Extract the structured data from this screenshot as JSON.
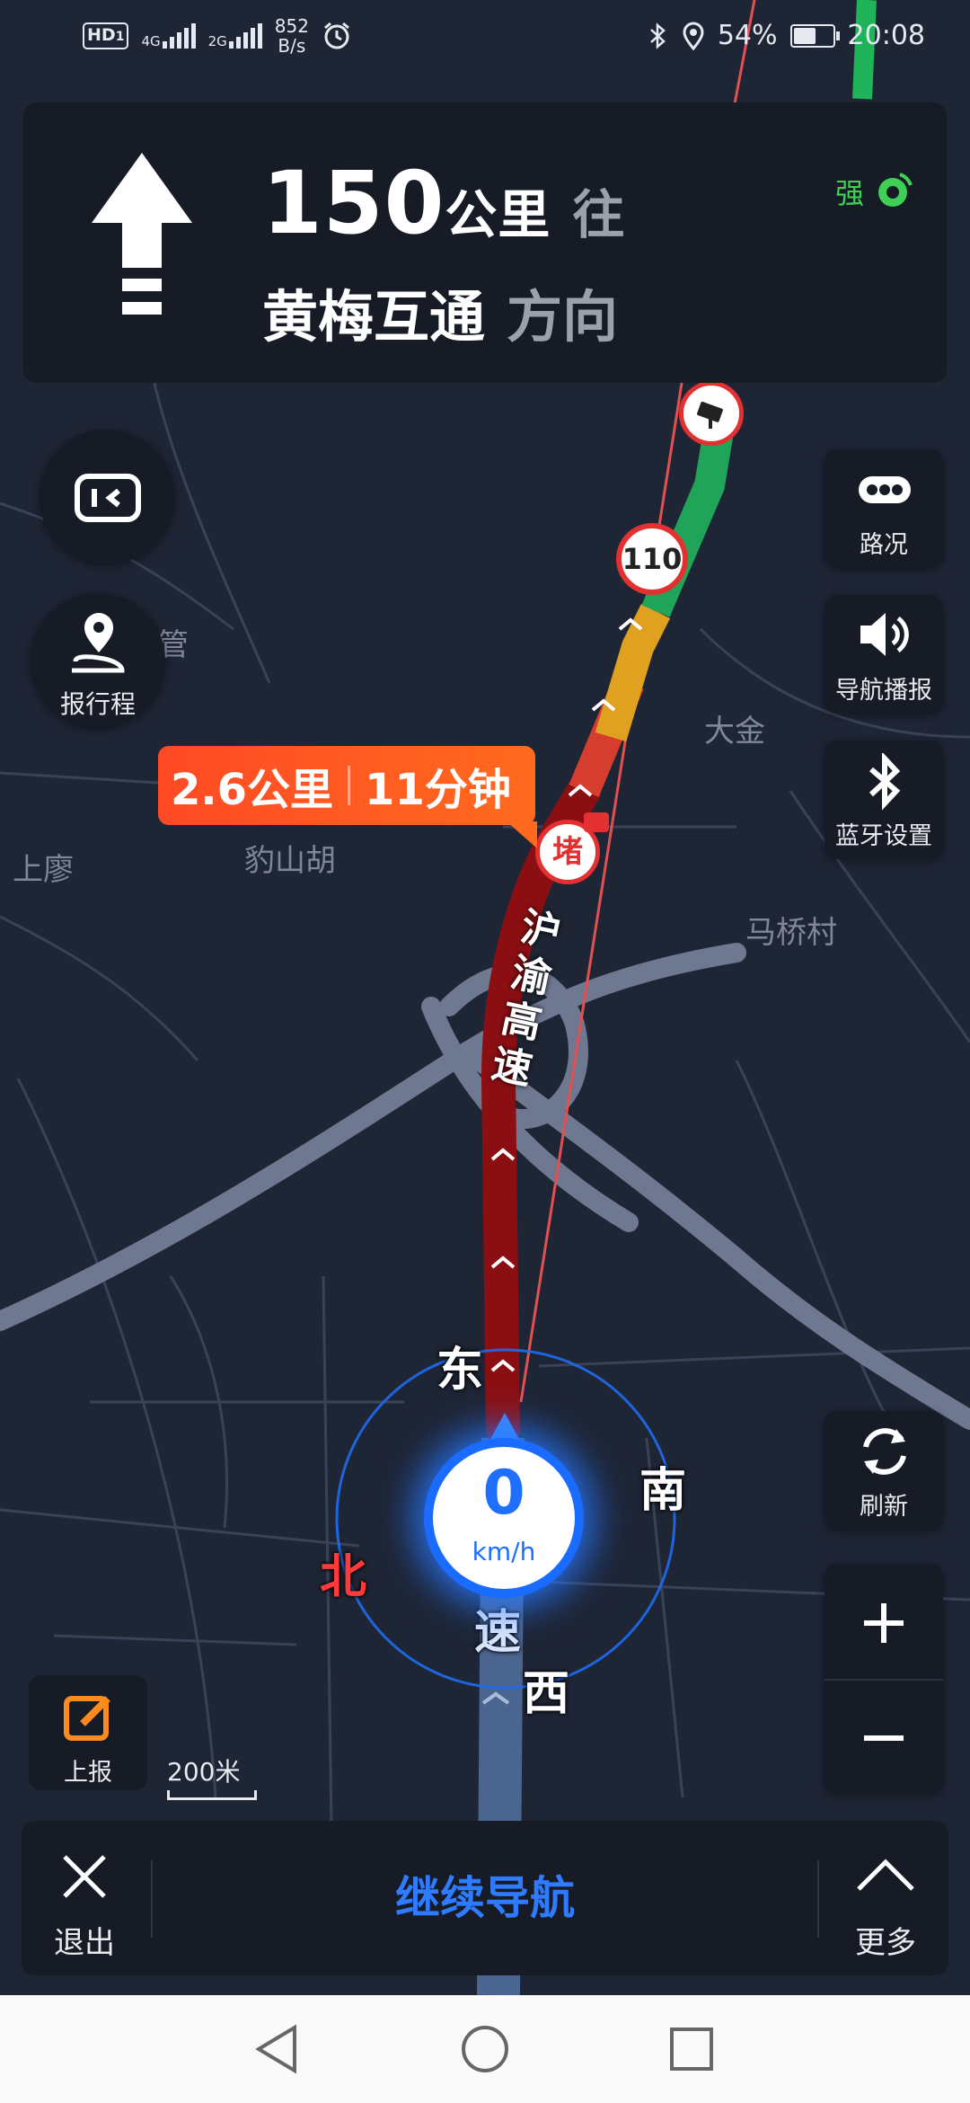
{
  "status_bar": {
    "hd": "HD",
    "hd_sub": "1",
    "net1": "4G",
    "net2": "2G",
    "speed_value": "852",
    "speed_unit": "B/s",
    "battery": "54%",
    "time": "20:08",
    "icons": [
      "alarm-icon",
      "bluetooth-icon",
      "location-icon",
      "battery-icon"
    ]
  },
  "guidance": {
    "distance": "150",
    "unit": "公里",
    "toward": "往",
    "road": "黄梅互通",
    "direction": "方向",
    "gps_label": "强"
  },
  "left_buttons": {
    "trip_label": "报行程"
  },
  "right_buttons": {
    "traffic": "路况",
    "voice": "导航播报",
    "bluetooth": "蓝牙设置",
    "refresh": "刷新"
  },
  "route_tag": {
    "distance": "2.6公里",
    "time": "11分钟"
  },
  "map": {
    "speed_limit": "110",
    "jam_badge": "堵",
    "highway_name": "沪渝高速",
    "places": [
      "管",
      "大金",
      "上廖",
      "豹山胡",
      "马桥村"
    ],
    "compass": {
      "east": "东",
      "south": "南",
      "north": "北",
      "west": "西"
    },
    "speed_char": "速",
    "colors": {
      "background": "#1e2535",
      "road": "#6e7890",
      "congested": "#8b0f12",
      "slow": "#e0a020",
      "smooth": "#20a45a",
      "accent": "#2e7bff"
    }
  },
  "speed": {
    "value": "0",
    "unit": "km/h"
  },
  "report_label": "上报",
  "scale_label": "200米",
  "bottom_bar": {
    "exit": "退出",
    "continue": "继续导航",
    "more": "更多"
  }
}
